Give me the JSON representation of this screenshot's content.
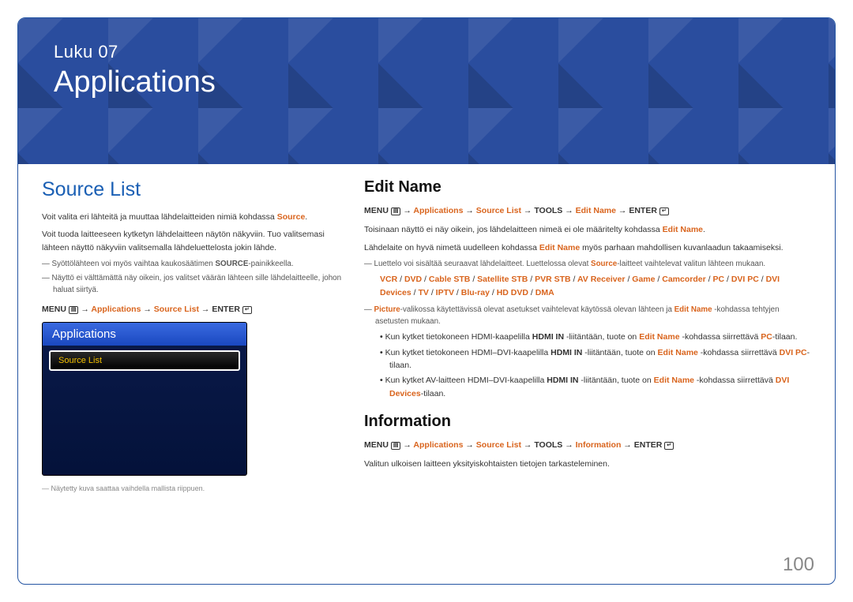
{
  "header": {
    "chapter_label": "Luku  07",
    "chapter_title": "Applications"
  },
  "left": {
    "heading": "Source List",
    "p1_pre": "Voit valita eri lähteitä ja muuttaa lähdelaitteiden nimiä kohdassa ",
    "p1_hl": "Source",
    "p1_post": ".",
    "p2": "Voit tuoda laitteeseen kytketyn lähdelaitteen näytön näkyviin. Tuo valitsemasi lähteen näyttö näkyviin valitsemalla lähdeluettelosta jokin lähde.",
    "note1_pre": "Syöttölähteen voi myös vaihtaa kaukosäätimen ",
    "note1_bold": "SOURCE",
    "note1_post": "-painikkeella.",
    "note2": "Näyttö ei välttämättä näy oikein, jos valitset väärän lähteen sille lähdelaitteelle, johon haluat siirtyä.",
    "menu_path": {
      "m": "MENU",
      "a": "Applications",
      "s": "Source List",
      "e": "ENTER"
    },
    "screen": {
      "title": "Applications",
      "item": "Source List"
    },
    "footer_note": "Näytetty kuva saattaa vaihdella mallista riippuen."
  },
  "right": {
    "edit": {
      "heading": "Edit Name",
      "menu_path": {
        "m": "MENU",
        "a": "Applications",
        "s": "Source List",
        "t": "TOOLS",
        "en": "Edit Name",
        "e": "ENTER"
      },
      "p1_pre": "Toisinaan näyttö ei näy oikein, jos lähdelaitteen nimeä ei ole määritelty kohdassa ",
      "p1_hl": "Edit Name",
      "p1_post": ".",
      "p2_pre": "Lähdelaite on hyvä nimetä uudelleen kohdassa ",
      "p2_hl": "Edit Name",
      "p2_post": " myös parhaan mahdollisen kuvanlaadun takaamiseksi.",
      "note_list_pre": "Luettelo voi sisältää seuraavat lähdelaitteet. Luettelossa olevat ",
      "note_list_hl": "Source",
      "note_list_post": "-laitteet vaihtelevat valitun lähteen mukaan.",
      "sources": [
        "VCR",
        "DVD",
        "Cable STB",
        "Satellite STB",
        "PVR STB",
        "AV Receiver",
        "Game",
        "Camcorder",
        "PC",
        "DVI PC",
        "DVI Devices",
        "TV",
        "IPTV",
        "Blu-ray",
        "HD DVD",
        "DMA"
      ],
      "note_picture_hl": "Picture",
      "note_picture_mid": "-valikossa käytettävissä olevat asetukset vaihtelevat käytössä olevan lähteen ja ",
      "note_picture_hl2": "Edit Name",
      "note_picture_post": " -kohdassa tehtyjen asetusten mukaan.",
      "b1_pre": "Kun kytket tietokoneen HDMI-kaapelilla ",
      "b1_bold": "HDMI IN",
      "b1_mid": " -liitäntään, tuote on ",
      "b1_hl1": "Edit Name",
      "b1_mid2": " -kohdassa siirrettävä ",
      "b1_hl2": "PC",
      "b1_post": "-tilaan.",
      "b2_pre": "Kun kytket tietokoneen HDMI–DVI-kaapelilla ",
      "b2_bold": "HDMI IN",
      "b2_mid": " -liitäntään, tuote on ",
      "b2_hl1": "Edit Name",
      "b2_mid2": " -kohdassa siirrettävä ",
      "b2_hl2": "DVI PC",
      "b2_post": "-tilaan.",
      "b3_pre": "Kun kytket AV-laitteen HDMI–DVI-kaapelilla ",
      "b3_bold": "HDMI IN",
      "b3_mid": " -liitäntään, tuote on ",
      "b3_hl1": "Edit Name",
      "b3_mid2": " -kohdassa siirrettävä ",
      "b3_hl2": "DVI Devices",
      "b3_post": "-tilaan."
    },
    "info": {
      "heading": "Information",
      "menu_path": {
        "m": "MENU",
        "a": "Applications",
        "s": "Source List",
        "t": "TOOLS",
        "i": "Information",
        "e": "ENTER"
      },
      "p1": "Valitun ulkoisen laitteen yksityiskohtaisten tietojen tarkasteleminen."
    }
  },
  "page_number": "100"
}
